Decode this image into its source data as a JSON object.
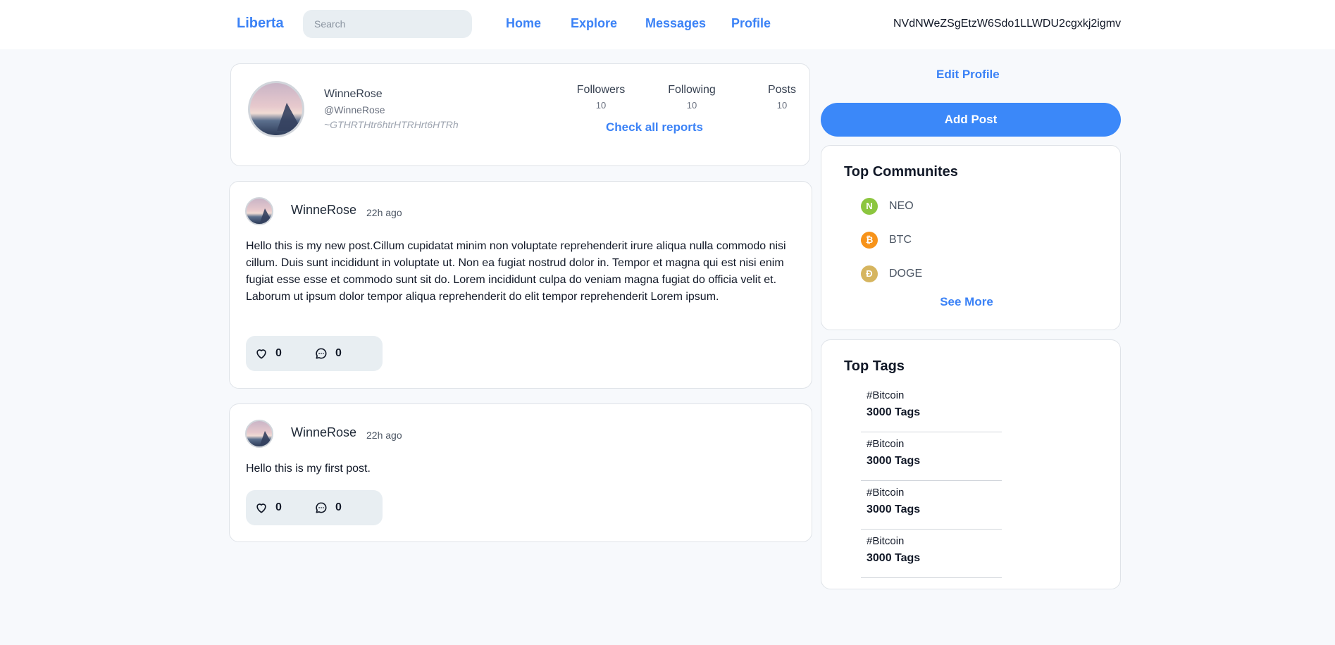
{
  "nav": {
    "brand": "Liberta",
    "search_placeholder": "Search",
    "links": [
      "Home",
      "Explore",
      "Messages",
      "Profile"
    ],
    "wallet_address": "NVdNWeZSgEtzW6Sdo1LLWDU2cgxkj2igmv"
  },
  "profile": {
    "name": "WinneRose",
    "handle": "@WinneRose",
    "bio": "~GTHRTHtr6htrHTRHrt6HTRh",
    "stats": [
      {
        "label": "Followers",
        "value": "10"
      },
      {
        "label": "Following",
        "value": "10"
      },
      {
        "label": "Posts",
        "value": "10"
      }
    ],
    "reports_link": "Check all reports"
  },
  "posts": [
    {
      "author": "WinneRose",
      "time": "22h ago",
      "body": "Hello this is my new post.Cillum cupidatat minim non voluptate reprehenderit irure aliqua nulla commodo nisi cillum. Duis sunt incididunt in voluptate ut. Non ea fugiat nostrud dolor in. Tempor et magna qui est nisi enim fugiat esse esse et commodo sunt sit do. Lorem incididunt culpa do veniam magna fugiat do officia velit et. Laborum ut ipsum dolor tempor aliqua reprehenderit do elit tempor reprehenderit Lorem ipsum.",
      "likes": "0",
      "comments": "0"
    },
    {
      "author": "WinneRose",
      "time": "22h ago",
      "body": "Hello this is my first post.",
      "likes": "0",
      "comments": "0"
    }
  ],
  "sidebar": {
    "edit_profile": "Edit Profile",
    "add_post": "Add Post",
    "communities_title": "Top Communites",
    "communities": [
      {
        "name": "NEO",
        "icon": "neo-icon",
        "color": "#8cc63f",
        "glyph": "N"
      },
      {
        "name": "BTC",
        "icon": "bitcoin-icon",
        "color": "#f7931a",
        "glyph": "₿"
      },
      {
        "name": "DOGE",
        "icon": "dogecoin-icon",
        "color": "#d6b55f",
        "glyph": "Ð"
      }
    ],
    "see_more": "See More",
    "tags_title": "Top Tags",
    "tags": [
      {
        "name": "#Bitcoin",
        "count": "3000 Tags"
      },
      {
        "name": "#Bitcoin",
        "count": "3000 Tags"
      },
      {
        "name": "#Bitcoin",
        "count": "3000 Tags"
      },
      {
        "name": "#Bitcoin",
        "count": "3000 Tags"
      }
    ]
  },
  "colors": {
    "accent": "#3b82f6",
    "background": "#f7f9fc",
    "card": "#ffffff",
    "action_bar": "#e8eef2"
  }
}
